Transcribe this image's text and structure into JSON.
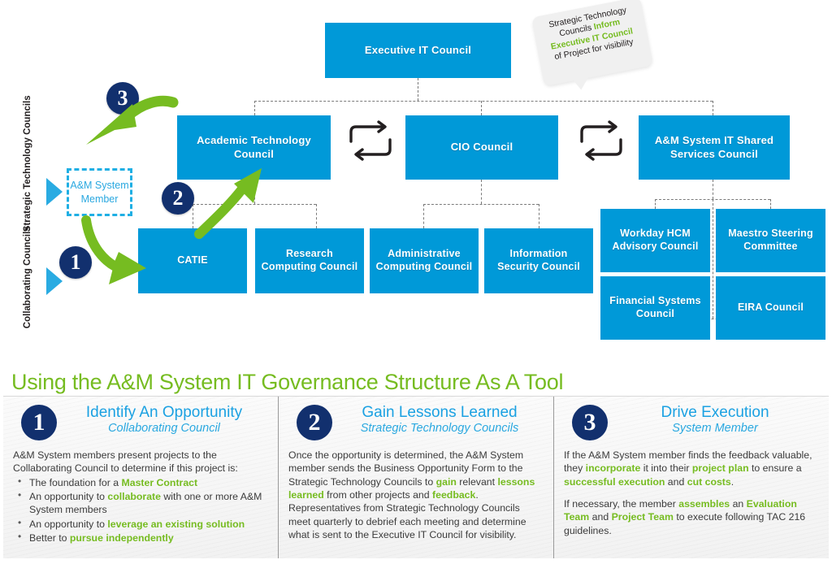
{
  "chart": {
    "nodes": [
      {
        "id": "exec",
        "label": "Executive IT Council"
      },
      {
        "id": "atc",
        "label": "Academic Technology Council"
      },
      {
        "id": "cio",
        "label": "CIO Council"
      },
      {
        "id": "shared",
        "label": "A&M System IT Shared Services Council"
      },
      {
        "id": "catie",
        "label": "CATIE"
      },
      {
        "id": "rcc",
        "label": "Research Computing Council"
      },
      {
        "id": "acc",
        "label": "Administrative Computing Council"
      },
      {
        "id": "isc",
        "label": "Information Security Council"
      },
      {
        "id": "workday",
        "label": "Workday HCM Advisory Council"
      },
      {
        "id": "maestro",
        "label": "Maestro Steering Committee"
      },
      {
        "id": "financial",
        "label": "Financial Systems Council"
      },
      {
        "id": "eira",
        "label": "EIRA Council"
      }
    ],
    "member_box": "A&M System Member",
    "axis_labels": [
      {
        "id": "strategic",
        "label": "Strategic Technology Councils"
      },
      {
        "id": "collaborating",
        "label": "Collaborating Councils"
      }
    ],
    "step_badges": [
      "1",
      "2",
      "3"
    ],
    "callout": {
      "line1": "Strategic Technology",
      "line2_pre": "Councils ",
      "line2_hl": "Inform",
      "line3_hl": "Executive IT Council",
      "line4": "of Project for visibility"
    },
    "swap_icon_name": "exchange-arrows-icon"
  },
  "bottom": {
    "headline": "Using the A&M System IT Governance Structure As A Tool",
    "columns": [
      {
        "number": "1",
        "title": "Identify An Opportunity",
        "subtitle": "Collaborating Council",
        "intro": "A&M System members present projects to the Collaborating Council to determine if this project is:",
        "bullets": [
          {
            "pre": "The foundation for a ",
            "hl": "Master Contract",
            "post": ""
          },
          {
            "pre": "An opportunity to ",
            "hl": "collaborate",
            "post": " with one or more A&M System members"
          },
          {
            "pre": "An opportunity to ",
            "hl": "leverage an existing solution",
            "post": ""
          },
          {
            "pre": "Better to ",
            "hl": "pursue independently",
            "post": ""
          }
        ]
      },
      {
        "number": "2",
        "title": "Gain Lessons Learned",
        "subtitle": "Strategic Technology Councils",
        "p1_a": "Once the opportunity is determined, the A&M System member sends the Business Opportunity Form to the Strategic Technology Councils to ",
        "p1_hl1": "gain",
        "p1_b": " relevant ",
        "p1_hl2": "lessons learned",
        "p1_c": " from other projects and ",
        "p1_hl3": "feedback",
        "p1_d": ". Representatives from Strategic Technology Councils meet quarterly to debrief each meeting and determine what is sent to the Executive IT Council for visibility."
      },
      {
        "number": "3",
        "title": "Drive Execution",
        "subtitle": "System Member",
        "p1_a": "If the A&M System member finds the feedback valuable, they ",
        "p1_hl1": "incorporate",
        "p1_b": " it into their ",
        "p1_hl2": "project plan",
        "p1_c": " to ensure a ",
        "p1_hl3": "successful execution",
        "p1_d": " and ",
        "p1_hl4": "cut costs",
        "p1_e": ".",
        "p2_a": "If necessary, the member ",
        "p2_hl1": "assembles",
        "p2_b": " an ",
        "p2_hl2": "Evaluation Team",
        "p2_c": " and ",
        "p2_hl3": "Project Team",
        "p2_d": " to execute following TAC 216 guidelines."
      }
    ]
  },
  "colors": {
    "node_blue": "#0099D8",
    "accent_cyan": "#29ABE2",
    "navy": "#12306E",
    "green": "#76BC21",
    "panel_gray": "#f2f2f2"
  }
}
